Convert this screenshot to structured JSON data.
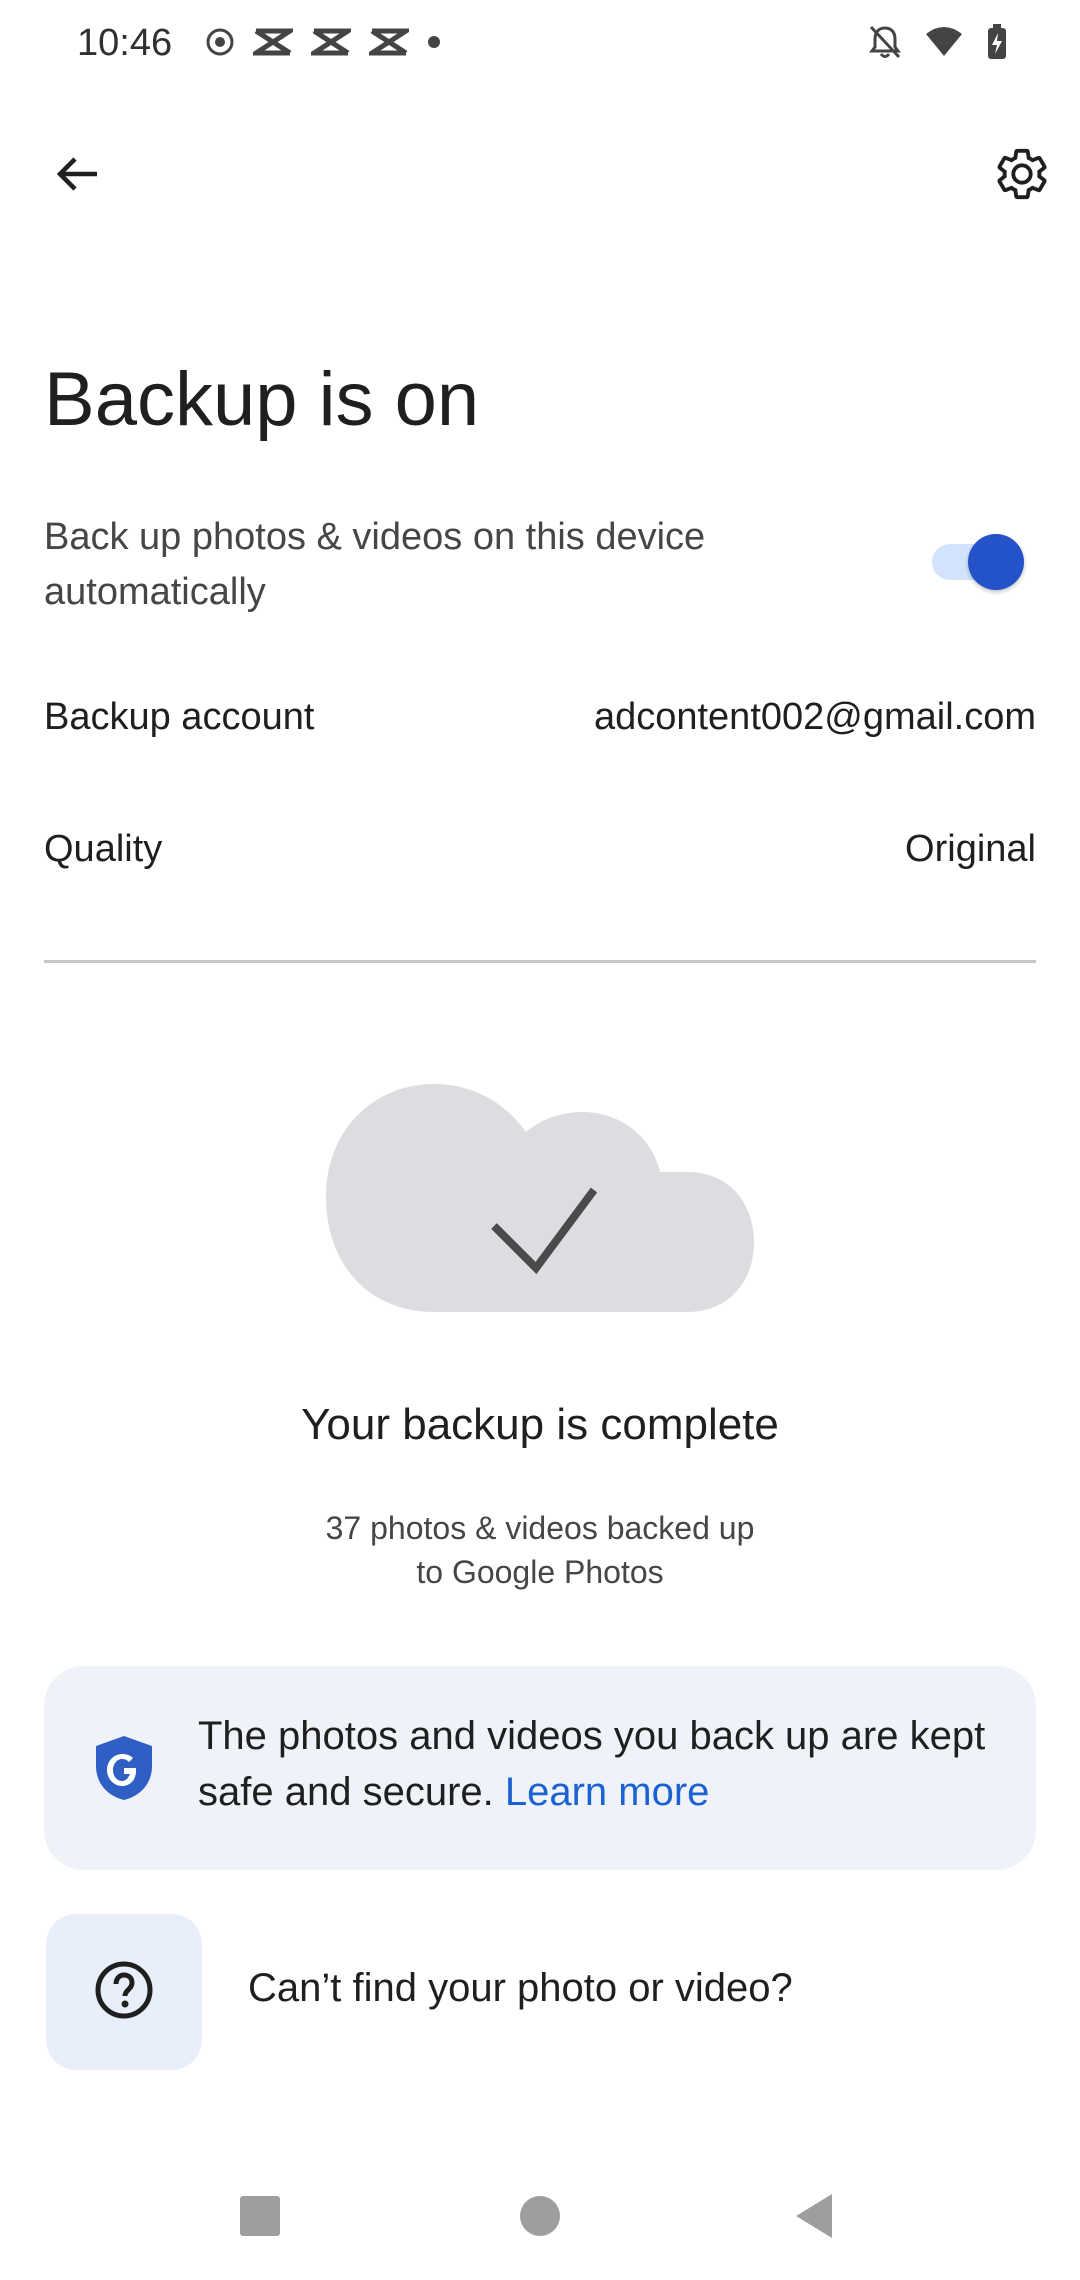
{
  "status_bar": {
    "time": "10:46",
    "left_icons": [
      "record-icon",
      "app-icon",
      "app-icon",
      "app-icon",
      "dot-icon"
    ],
    "right_icons": [
      "bell-off-icon",
      "wifi-icon",
      "battery-charging-icon"
    ]
  },
  "toolbar": {
    "back_icon": "arrow-back-icon",
    "settings_icon": "gear-icon"
  },
  "page": {
    "title": "Backup is on",
    "toggle_text": "Back up photos & videos on this device automatically",
    "toggle_on": true,
    "backup_account_label": "Backup account",
    "backup_account_value": "adcontent002@gmail.com",
    "quality_label": "Quality",
    "quality_value": "Original"
  },
  "status": {
    "title": "Your backup is complete",
    "line1": "37 photos & videos backed up",
    "line2": "to Google Photos"
  },
  "secure_card": {
    "text": "The photos and videos you back up are kept safe and secure.",
    "link": "Learn more"
  },
  "help": {
    "label": "Can’t find your photo or video?"
  },
  "colors": {
    "accent": "#2453c9",
    "link": "#1a62d1",
    "card_bg": "#eff3f9",
    "cloud": "#dcdde1"
  },
  "nav": {
    "icons": [
      "recents-square-icon",
      "home-circle-icon",
      "back-triangle-icon"
    ]
  }
}
